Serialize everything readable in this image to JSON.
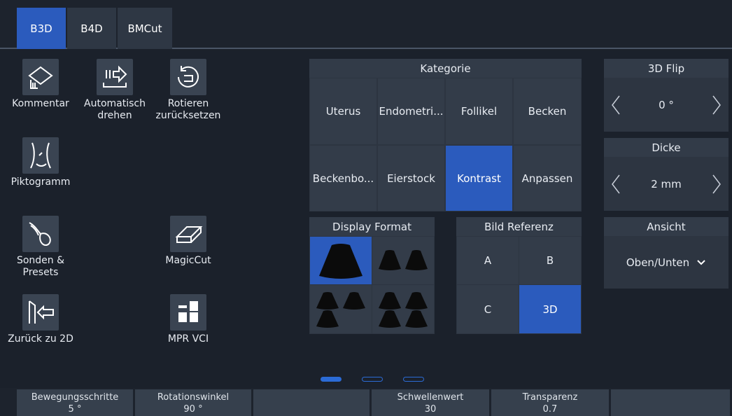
{
  "tabs": [
    {
      "label": "B3D",
      "active": true
    },
    {
      "label": "B4D",
      "active": false
    },
    {
      "label": "BMCut",
      "active": false
    }
  ],
  "tools": {
    "kommentar": {
      "label": "Kommentar",
      "icon": "annotation-icon"
    },
    "automatisch_drehen": {
      "label_line1": "Automatisch",
      "label_line2": "drehen",
      "icon": "auto-rotate-icon"
    },
    "rotieren_zuruecksetzen": {
      "label_line1": "Rotieren",
      "label_line2": "zurücksetzen",
      "icon": "reset-rotation-icon"
    },
    "piktogramm": {
      "label": "Piktogramm",
      "icon": "body-pictogram-icon"
    },
    "sonden_presets": {
      "label_line1": "Sonden &",
      "label_line2": "Presets",
      "icon": "probe-icon"
    },
    "magiccut": {
      "label": "MagicCut",
      "icon": "eraser-icon"
    },
    "zurueck_2d": {
      "label": "Zurück zu 2D",
      "icon": "back-to-2d-icon"
    },
    "mpr_vci": {
      "label": "MPR VCI",
      "icon": "layout-grid-icon"
    }
  },
  "kategorie": {
    "title": "Kategorie",
    "items": [
      {
        "label": "Uterus",
        "active": false
      },
      {
        "label": "Endometri...",
        "active": false
      },
      {
        "label": "Follikel",
        "active": false
      },
      {
        "label": "Becken",
        "active": false
      },
      {
        "label": "Beckenbo...",
        "active": false
      },
      {
        "label": "Eierstock",
        "active": false
      },
      {
        "label": "Kontrast",
        "active": true
      },
      {
        "label": "Anpassen",
        "active": false
      }
    ]
  },
  "flip": {
    "title": "3D Flip",
    "value": "0 °"
  },
  "dicke": {
    "title": "Dicke",
    "value": "2 mm"
  },
  "ansicht": {
    "title": "Ansicht",
    "value": "Oben/Unten"
  },
  "display_format": {
    "title": "Display Format",
    "selected_index": 0
  },
  "bild_referenz": {
    "title": "Bild Referenz",
    "items": [
      {
        "label": "A",
        "active": false
      },
      {
        "label": "B",
        "active": false
      },
      {
        "label": "C",
        "active": false
      },
      {
        "label": "3D",
        "active": true
      }
    ]
  },
  "page_indicator": {
    "pages": 3,
    "current": 1
  },
  "params": [
    {
      "label": "Bewegungsschritte",
      "value": "5 °"
    },
    {
      "label": "Rotationswinkel",
      "value": "90 °"
    },
    {
      "label": "",
      "value": ""
    },
    {
      "label": "Schwellenwert",
      "value": "30"
    },
    {
      "label": "Transparenz",
      "value": "0.7"
    },
    {
      "label": "",
      "value": ""
    }
  ],
  "colors": {
    "accent": "#2b5bbd",
    "background": "#1b212b",
    "panel": "#2d3541"
  }
}
